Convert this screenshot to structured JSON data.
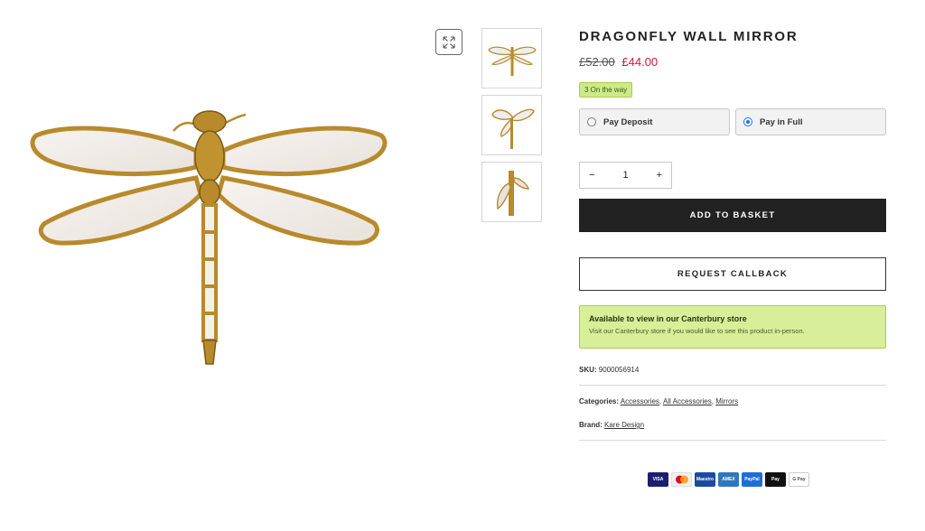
{
  "product": {
    "title": "DRAGONFLY WALL MIRROR",
    "price_old": "£52.00",
    "price_new": "£44.00",
    "stock_badge": "3 On the way"
  },
  "payment_options": [
    {
      "label": "Pay Deposit",
      "selected": false
    },
    {
      "label": "Pay in Full",
      "selected": true
    }
  ],
  "quantity": {
    "minus": "−",
    "value": "1",
    "plus": "+"
  },
  "buttons": {
    "add_to_basket": "ADD TO BASKET",
    "request_callback": "REQUEST CALLBACK"
  },
  "store_notice": {
    "title": "Available to view in our Canterbury store",
    "text": "Visit our Canterbury store if you would like to see this product in-person."
  },
  "meta": {
    "sku_label": "SKU:",
    "sku_value": "9000056914",
    "categories_label": "Categories:",
    "categories": [
      "Accessories",
      "All Accessories",
      "Mirrors"
    ],
    "brand_label": "Brand:",
    "brand_value": "Kare Design"
  },
  "payment_icons": [
    {
      "label": "VISA",
      "color": "#1a1f71"
    },
    {
      "label": "MC",
      "color": "#f0f0f0"
    },
    {
      "label": "Maestro",
      "color": "#1c4aa3"
    },
    {
      "label": "AMEX",
      "color": "#2e77bc"
    },
    {
      "label": "PayPal",
      "color": "#1f6dd6"
    },
    {
      "label": " Pay",
      "color": "#111111"
    },
    {
      "label": "G Pay",
      "color": "#ffffff"
    }
  ],
  "icons": {
    "zoom": "expand-icon",
    "gold": "#b88a2c"
  }
}
